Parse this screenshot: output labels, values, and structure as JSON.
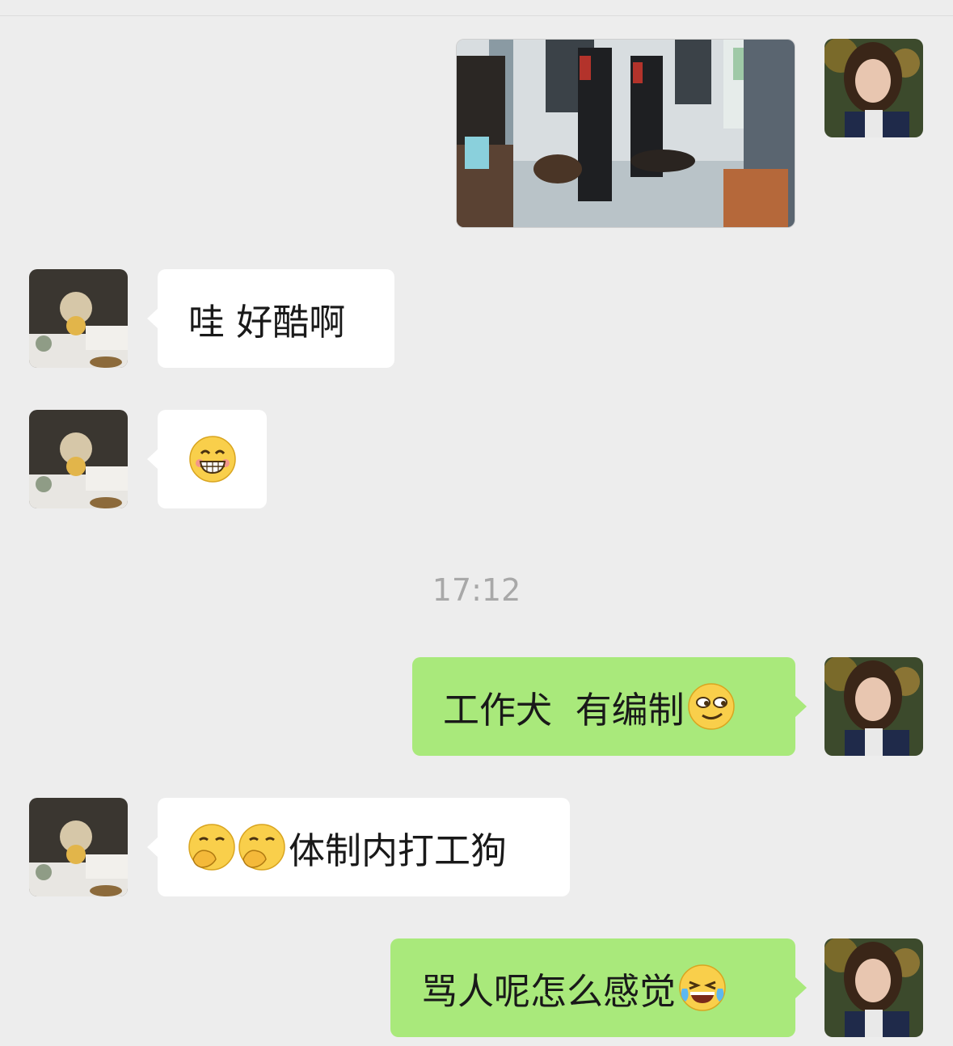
{
  "chat": {
    "timestamp": "17:12",
    "messages": [
      {
        "sender": "me",
        "type": "image",
        "image_desc": "subway-patrol-dogs"
      },
      {
        "sender": "friend",
        "type": "text",
        "text": "哇 好酷啊"
      },
      {
        "sender": "friend",
        "type": "emoji",
        "emoji": "grin-emoji"
      },
      {
        "sender": "me",
        "type": "text",
        "text": "工作犬  有编制",
        "emoji": "smirk-emoji"
      },
      {
        "sender": "friend",
        "type": "text",
        "prefix_emoji": [
          "facepalm-emoji",
          "facepalm-emoji"
        ],
        "text": "体制内打工狗"
      },
      {
        "sender": "me",
        "type": "text",
        "text": "骂人呢怎么感觉",
        "emoji": "laugh-cry-emoji"
      }
    ]
  },
  "colors": {
    "background": "#ededed",
    "incoming_bubble": "#ffffff",
    "outgoing_bubble": "#a9e97b",
    "timestamp_text": "#a8a8a8"
  }
}
